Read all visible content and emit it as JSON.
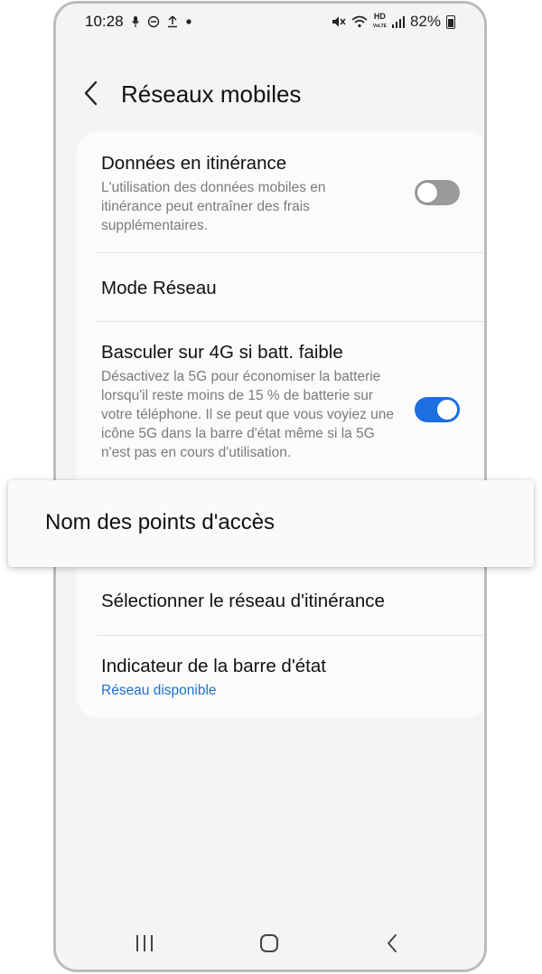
{
  "status_bar": {
    "time": "10:28",
    "hd_label_top": "HD",
    "hd_label_bottom": "VoLTE",
    "battery": "82%"
  },
  "header": {
    "title": "Réseaux mobiles"
  },
  "settings": {
    "roaming": {
      "title": "Données en itinérance",
      "subtitle": "L'utilisation des données mobiles en itinérance peut entraîner des frais supplémentaires.",
      "enabled": false
    },
    "network_mode": {
      "title": "Mode Réseau"
    },
    "switch_4g": {
      "title": "Basculer sur 4G si batt. faible",
      "subtitle": "Désactivez la 5G pour économiser la batterie lorsqu'il reste moins de 15 % de batterie sur votre téléphone. Il se peut que vous voyiez une icône 5G dans la barre d'état même si la 5G n'est pas en cours d'utilisation.",
      "enabled": true
    },
    "select_roaming_network": {
      "title": "Sélectionner le réseau d'itinérance"
    },
    "status_indicator": {
      "title": "Indicateur de la barre d'état",
      "value": "Réseau disponible"
    }
  },
  "highlight": {
    "label": "Nom des points d'accès"
  },
  "colors": {
    "accent": "#1d6fe0",
    "link": "#1a6fcf",
    "toggle_off": "#9a9a9a"
  }
}
